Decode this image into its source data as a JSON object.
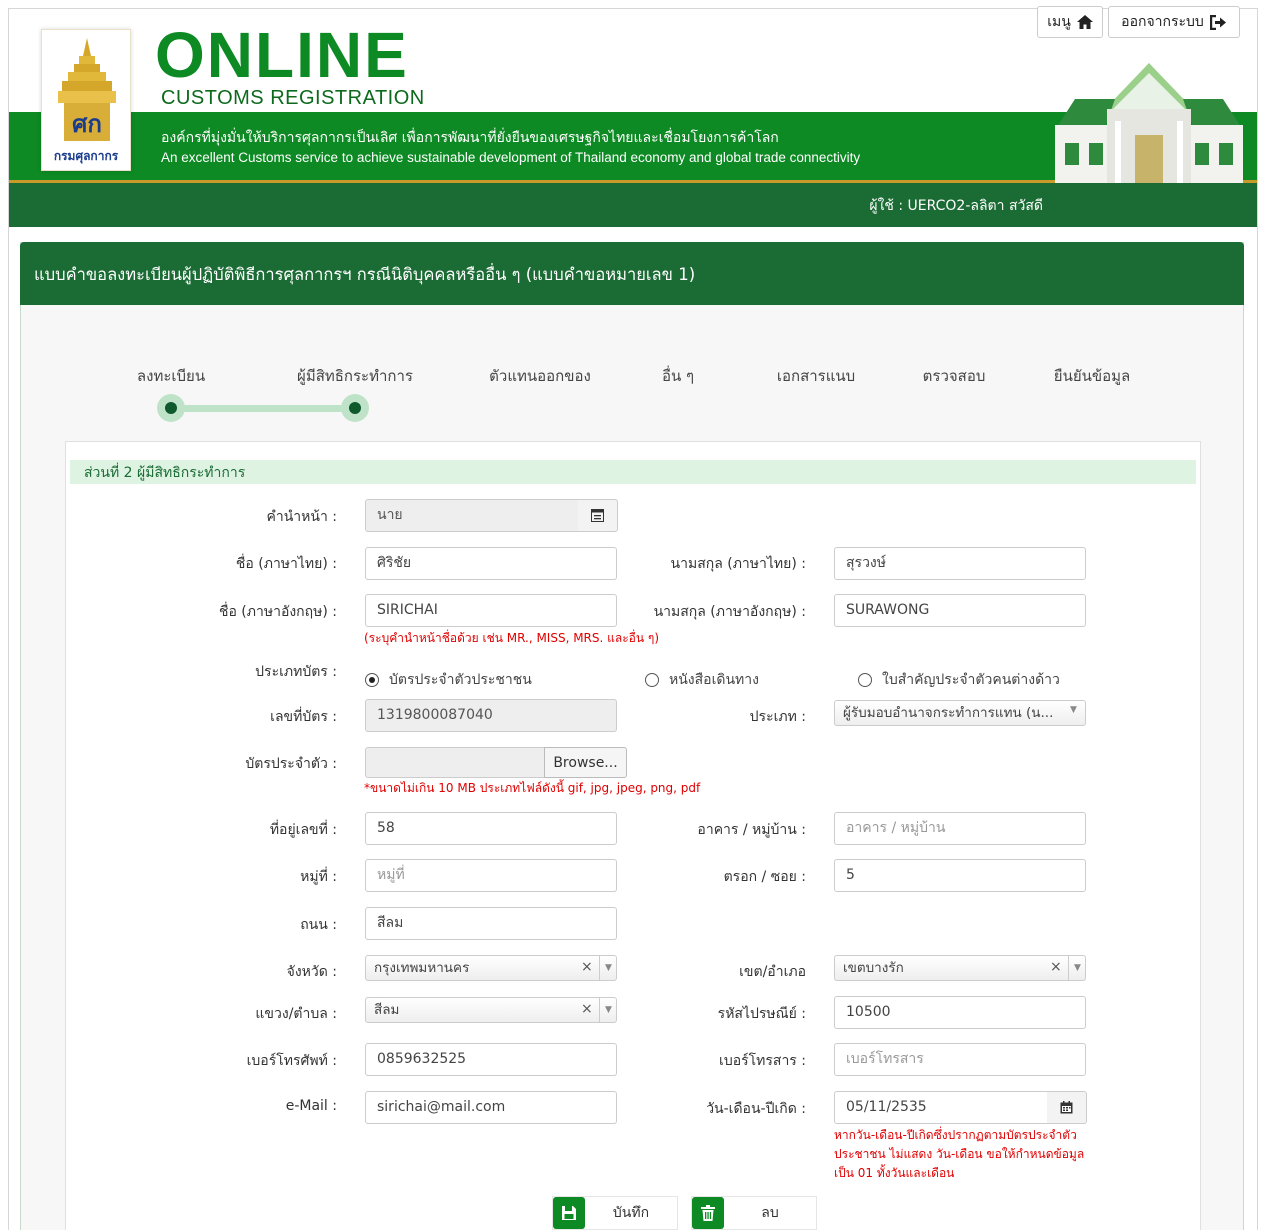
{
  "header": {
    "logo_text": "กรมศุลกากร",
    "brand_title": "ONLINE",
    "brand_subtitle": "CUSTOMS REGISTRATION",
    "slogan_th": "องค์กรที่มุ่งมั่นให้บริการศุลกากรเป็นเลิศ เพื่อการพัฒนาที่ยั่งยืนของเศรษฐกิจไทยและเชื่อมโยงการค้าโลก",
    "slogan_en": "An excellent Customs service to achieve sustainable development of Thailand economy and global trade connectivity",
    "colors": {
      "brand_green": "#0d8a23",
      "bar_green": "#1a6b34",
      "gold": "#c89a2a"
    }
  },
  "userbar": {
    "user_text": "ผู้ใช้ : UERCO2-ลลิตา สวัสดี",
    "menu_label": "เมนู",
    "menu_icon": "home-icon",
    "logout_label": "ออกจากระบบ",
    "logout_icon": "sign-out-icon"
  },
  "panel": {
    "title": "แบบคำขอลงทะเบียนผู้ปฏิบัติพิธีการศุลกากรฯ กรณีนิติบุคคลหรืออื่น ๆ (แบบคำขอหมายเลข 1)"
  },
  "steps": [
    {
      "label": "ลงทะเบียน",
      "done": true
    },
    {
      "label": "ผู้มีสิทธิกระทำการ",
      "done": true
    },
    {
      "label": "ตัวแทนออกของ",
      "done": false
    },
    {
      "label": "อื่น ๆ",
      "done": false
    },
    {
      "label": "เอกสารแนบ",
      "done": false
    },
    {
      "label": "ตรวจสอบ",
      "done": false
    },
    {
      "label": "ยืนยันข้อมูล",
      "done": false
    }
  ],
  "form": {
    "section_title": "ส่วนที่ 2 ผู้มีสิทธิกระทำการ",
    "prefix": {
      "label": "คำนำหน้า :",
      "value": "นาย"
    },
    "first_name_th": {
      "label": "ชื่อ (ภาษาไทย) :",
      "value": "ศิริชัย"
    },
    "last_name_th": {
      "label": "นามสกุล (ภาษาไทย) :",
      "value": "สุรวงษ์"
    },
    "first_name_en": {
      "label": "ชื่อ (ภาษาอังกฤษ) :",
      "value": "SIRICHAI",
      "hint": "(ระบุคำนำหน้าชื่อด้วย เช่น MR., MISS, MRS. และอื่น ๆ)"
    },
    "last_name_en": {
      "label": "นามสกุล (ภาษาอังกฤษ) :",
      "value": "SURAWONG"
    },
    "card_type": {
      "label": "ประเภทบัตร :",
      "options": [
        "บัตรประจำตัวประชาชน",
        "หนังสือเดินทาง",
        "ใบสำคัญประจำตัวคนต่างด้าว"
      ],
      "selected": "บัตรประจำตัวประชาชน"
    },
    "card_no": {
      "label": "เลขที่บัตร :",
      "value": "1319800087040"
    },
    "category": {
      "label": "ประเภท :",
      "value": "ผู้รับมอบอำนาจกระทำการแทน (น..."
    },
    "id_card_file": {
      "label": "บัตรประจำตัว :",
      "browse_label": "Browse...",
      "hint": "*ขนาดไม่เกิน 10 MB ประเภทไฟล์ดังนี้ gif, jpg, jpeg, png, pdf"
    },
    "address_no": {
      "label": "ที่อยู่เลขที่ :",
      "value": "58"
    },
    "building": {
      "label": "อาคาร / หมู่บ้าน :",
      "placeholder": "อาคาร / หมู่บ้าน"
    },
    "moo": {
      "label": "หมู่ที่ :",
      "placeholder": "หมู่ที่"
    },
    "soi": {
      "label": "ตรอก / ซอย :",
      "value": "5"
    },
    "road": {
      "label": "ถนน :",
      "value": "สีลม"
    },
    "province": {
      "label": "จังหวัด :",
      "value": "กรุงเทพมหานคร"
    },
    "district": {
      "label": "เขต/อำเภอ",
      "value": "เขตบางรัก"
    },
    "subdistrict": {
      "label": "แขวง/ตำบล :",
      "value": "สีลม"
    },
    "postcode": {
      "label": "รหัสไปรษณีย์ :",
      "value": "10500"
    },
    "phone": {
      "label": "เบอร์โทรศัพท์ :",
      "value": "0859632525"
    },
    "fax": {
      "label": "เบอร์โทรสาร :",
      "placeholder": "เบอร์โทรสาร"
    },
    "email": {
      "label": "e-Mail :",
      "value": "sirichai@mail.com"
    },
    "birthdate": {
      "label": "วัน-เดือน-ปีเกิด :",
      "value": "05/11/2535",
      "hint_lines": [
        "หากวัน-เดือน-ปีเกิดซึ่งปรากฏตามบัตรประจำตัว",
        "ประชาชน ไม่แสดง วัน-เดือน ขอให้กำหนดข้อมูล",
        "เป็น 01 ทั้งวันและเดือน"
      ]
    }
  },
  "actions": {
    "save_label": "บันทึก",
    "delete_label": "ลบ"
  },
  "select_clear": "×",
  "select_arrow": "▼"
}
